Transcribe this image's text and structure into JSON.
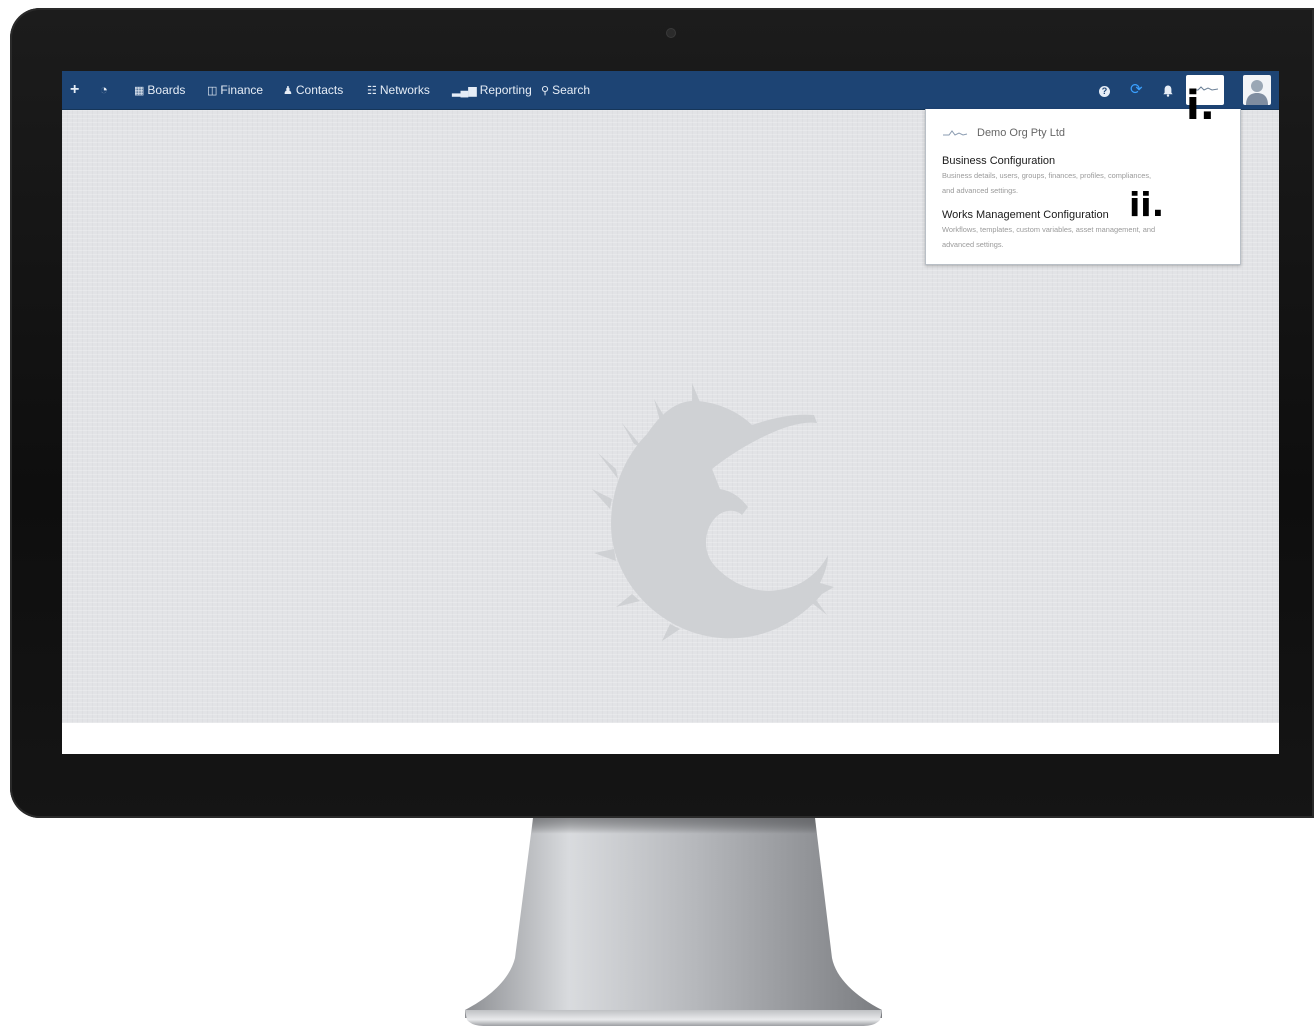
{
  "navbar": {
    "add_icon": "+",
    "dashboard_icon": "dashboard-icon",
    "boards": {
      "icon": "grid-icon",
      "label": "Boards"
    },
    "finance": {
      "icon": "columns-icon",
      "label": "Finance"
    },
    "contacts": {
      "icon": "users-icon",
      "label": "Contacts"
    },
    "networks": {
      "icon": "sitemap-icon",
      "label": "Networks"
    },
    "reporting": {
      "icon": "signal-icon",
      "label": "Reporting"
    },
    "search": {
      "icon": "search-icon",
      "label": "Search"
    },
    "help_icon": "?",
    "sync_icon": "refresh-icon",
    "notifications_icon": "bell-icon"
  },
  "dropdown": {
    "org_name": "Demo Org Pty Ltd",
    "items": [
      {
        "title": "Business Configuration",
        "description_line1": "Business details, users, groups, finances, profiles, compliances,",
        "description_line2": "and advanced settings."
      },
      {
        "title": "Works Management Configuration",
        "description_line1": "Workflows, templates, custom variables, asset management, and",
        "description_line2": "advanced settings."
      }
    ]
  },
  "annotations": {
    "marker_1": "i.",
    "marker_2": "ii."
  },
  "colors": {
    "navbar": "#1d4474",
    "sync_icon": "#3aa0ff",
    "workspace": "#e2e3e6"
  }
}
